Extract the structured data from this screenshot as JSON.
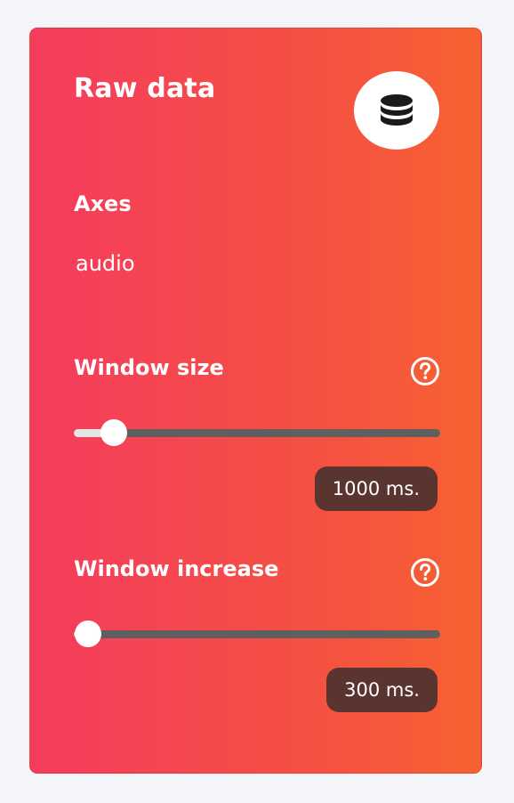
{
  "card": {
    "title": "Raw data",
    "icon": "database-icon"
  },
  "axes": {
    "label": "Axes",
    "value": "audio"
  },
  "window_size": {
    "label": "Window size",
    "help_icon": "question-circle-icon",
    "slider_fraction": 0.11,
    "value_text": "1000 ms."
  },
  "window_increase": {
    "label": "Window increase",
    "help_icon": "question-circle-icon",
    "slider_fraction": 0.04,
    "value_text": "300 ms."
  },
  "colors": {
    "gradient_start": "#f53c5e",
    "gradient_end": "#f66231",
    "badge_bg": "#5a3530",
    "track": "#5f5f5f"
  }
}
